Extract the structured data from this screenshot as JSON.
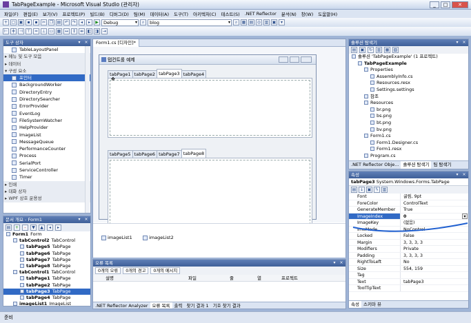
{
  "window": {
    "title": "TabPageExample - Microsoft Visual Studio (관리자)",
    "controls": [
      "_",
      "□",
      "✕"
    ]
  },
  "menu": [
    "파일(F)",
    "편집(E)",
    "보기(V)",
    "프로젝트(P)",
    "빌드(B)",
    "디버그(D)",
    "팀(M)",
    "데이터(A)",
    "도구(T)",
    "아키텍처(C)",
    "테스트(S)",
    ".NET Reflector",
    "분석(N)",
    "창(W)",
    "도움말(H)"
  ],
  "toolbar": {
    "config": "Debug",
    "platform": "blog"
  },
  "toolbox": {
    "title": "도구 상자",
    "items": [
      {
        "label": "TableLayoutPanel",
        "kind": "item"
      },
      {
        "label": "▸ 메뉴 및 도구 모음",
        "kind": "cat"
      },
      {
        "label": "▸ 데이터",
        "kind": "cat"
      },
      {
        "label": "▾ 구성 요소",
        "kind": "cat"
      },
      {
        "label": "포인터",
        "kind": "sel"
      },
      {
        "label": "BackgroundWorker",
        "kind": "item"
      },
      {
        "label": "DirectoryEntry",
        "kind": "item"
      },
      {
        "label": "DirectorySearcher",
        "kind": "item"
      },
      {
        "label": "ErrorProvider",
        "kind": "item"
      },
      {
        "label": "EventLog",
        "kind": "item"
      },
      {
        "label": "FileSystemWatcher",
        "kind": "item"
      },
      {
        "label": "HelpProvider",
        "kind": "item"
      },
      {
        "label": "ImageList",
        "kind": "item"
      },
      {
        "label": "MessageQueue",
        "kind": "item"
      },
      {
        "label": "PerformanceCounter",
        "kind": "item"
      },
      {
        "label": "Process",
        "kind": "item"
      },
      {
        "label": "SerialPort",
        "kind": "item"
      },
      {
        "label": "ServiceController",
        "kind": "item"
      },
      {
        "label": "Timer",
        "kind": "item"
      },
      {
        "label": "▸ 인쇄",
        "kind": "cat"
      },
      {
        "label": "▸ 대화 상자",
        "kind": "cat"
      },
      {
        "label": "▸ WPF 상호 운용성",
        "kind": "cat"
      }
    ]
  },
  "outline": {
    "title": "문서 개요 - Form1",
    "items": [
      {
        "name": "Form1",
        "type": "Form",
        "indent": 0
      },
      {
        "name": "tabControl2",
        "type": "TabControl",
        "indent": 1
      },
      {
        "name": "tabPage5",
        "type": "TabPage",
        "indent": 2
      },
      {
        "name": "tabPage6",
        "type": "TabPage",
        "indent": 2
      },
      {
        "name": "tabPage7",
        "type": "TabPage",
        "indent": 2
      },
      {
        "name": "tabPage8",
        "type": "TabPage",
        "indent": 2
      },
      {
        "name": "tabControl1",
        "type": "TabControl",
        "indent": 1
      },
      {
        "name": "tabPage1",
        "type": "TabPage",
        "indent": 2
      },
      {
        "name": "tabPage2",
        "type": "TabPage",
        "indent": 2
      },
      {
        "name": "tabPage3",
        "type": "TabPage",
        "indent": 2,
        "sel": true
      },
      {
        "name": "tabPage4",
        "type": "TabPage",
        "indent": 2
      },
      {
        "name": "imageList1",
        "type": "ImageList",
        "indent": 1
      }
    ]
  },
  "doc": {
    "tab": "Form1.cs [디자인]*",
    "form_title": "탭컨트롤 예제",
    "tabs1": [
      "tabPage1",
      "tabPage2",
      "tabPage3",
      "tabPage4"
    ],
    "tabs2": [
      "tabPage5",
      "tabPage6",
      "tabPage7",
      "tabPage8"
    ],
    "tray": [
      "imageList1",
      "imageList2"
    ]
  },
  "errors": {
    "title": "오류 목록",
    "filters": [
      "0개의 오류",
      "0개의 경고",
      "0개의 메시지"
    ],
    "cols": [
      "설명",
      "파일",
      "줄",
      "열",
      "프로젝트"
    ],
    "bottom_tabs": [
      ".NET Reflector Analyzer",
      "오류 목록",
      "출력",
      "찾기 결과 1",
      "기호 찾기 결과"
    ]
  },
  "solution": {
    "title": "솔루션 탐색기",
    "items": [
      {
        "label": "솔루션 'TabPageExample' (1 프로젝트)",
        "indent": 0
      },
      {
        "label": "TabPageExample",
        "indent": 1,
        "bold": true
      },
      {
        "label": "Properties",
        "indent": 2
      },
      {
        "label": "AssemblyInfo.cs",
        "indent": 3
      },
      {
        "label": "Resources.resx",
        "indent": 3
      },
      {
        "label": "Settings.settings",
        "indent": 3
      },
      {
        "label": "참조",
        "indent": 2
      },
      {
        "label": "Resources",
        "indent": 2
      },
      {
        "label": "br.png",
        "indent": 3
      },
      {
        "label": "bs.png",
        "indent": 3
      },
      {
        "label": "bt.png",
        "indent": 3
      },
      {
        "label": "bv.png",
        "indent": 3
      },
      {
        "label": "Form1.cs",
        "indent": 2
      },
      {
        "label": "Form1.Designer.cs",
        "indent": 3
      },
      {
        "label": "Form1.resx",
        "indent": 3
      },
      {
        "label": "Program.cs",
        "indent": 2
      }
    ],
    "tabs": [
      ".NET Reflector Obje...",
      "솔루션 탐색기",
      "팀 탐색기"
    ]
  },
  "props": {
    "title": "속성",
    "object": "tabPage3",
    "object_type": "System.Windows.Forms.TabPage",
    "rows": [
      {
        "k": "Font",
        "v": "굴림, 9pt"
      },
      {
        "k": "ForeColor",
        "v": "ControlText"
      },
      {
        "k": "GenerateMember",
        "v": "True"
      },
      {
        "k": "ImageIndex",
        "v": "0",
        "sel": true
      },
      {
        "k": "ImageKey",
        "v": "(없음)"
      },
      {
        "k": "ImeMode",
        "v": "NoControl"
      },
      {
        "k": "Locked",
        "v": "False"
      },
      {
        "k": "Margin",
        "v": "3, 3, 3, 3"
      },
      {
        "k": "Modifiers",
        "v": "Private"
      },
      {
        "k": "Padding",
        "v": "3, 3, 3, 3"
      },
      {
        "k": "RightToLeft",
        "v": "No"
      },
      {
        "k": "Size",
        "v": "554, 159"
      },
      {
        "k": "Tag",
        "v": ""
      },
      {
        "k": "Text",
        "v": "tabPage3"
      },
      {
        "k": "ToolTipText",
        "v": ""
      }
    ],
    "tabs": [
      "속성",
      "스키마 뷰"
    ]
  },
  "status": "준비",
  "colors": {
    "accent": "#316ac5",
    "header": "#4a6aa5",
    "annotation": "#2060d0"
  }
}
